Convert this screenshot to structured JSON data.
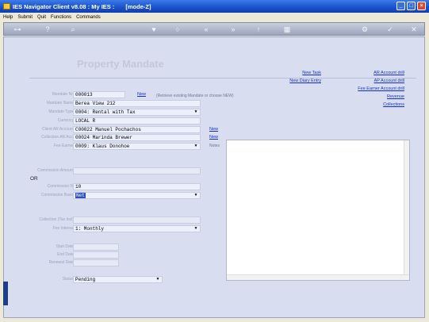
{
  "window": {
    "title": "IES Navigator Client v8.08 : My IES :",
    "mode": "[mode-Z]",
    "minimize": "_",
    "maximize": "□",
    "close": "×"
  },
  "menu": [
    "Help",
    "Submit",
    "Quit",
    "Functions",
    "Commands"
  ],
  "toolbar_icons": [
    "key-icon",
    "question-icon",
    "search-icon",
    "heart-icon",
    "globe-icon",
    "rewind-icon",
    "fast-forward-icon",
    "upload-icon",
    "calculator-icon",
    "settings-icon",
    "check-icon",
    "close-icon"
  ],
  "page_title": "Property Mandate",
  "form": {
    "mandate_no": {
      "label": "Mandate No",
      "value": "000013"
    },
    "new_link": "New",
    "new_hint": "(Retrieve existing Mandate or choose NEW)",
    "mandate_name": {
      "label": "Mandate Name",
      "value": "Berea View 212"
    },
    "mandate_type": {
      "label": "Mandate Type",
      "value": "0004: Rental with Tax"
    },
    "currency": {
      "label": "Currency",
      "value": "LOCAL R"
    },
    "client_ar_account": {
      "label": "Client AR Account",
      "value": "C00022 Manuel Pochachos"
    },
    "collection_ar": {
      "label": "Collection AR Acct",
      "value": "00024 Marinda Brewer"
    },
    "fee_earner": {
      "label": "Fee Earner",
      "value": "0009: Klaus Donohoe"
    },
    "commission_amount": {
      "label": "Commission Amount",
      "value": ""
    },
    "or_text": "OR",
    "commission_pct": {
      "label": "Commission %",
      "value": "10"
    },
    "commission_basis": {
      "label": "Commission Basis",
      "value": "Net"
    },
    "collection_fee": {
      "label": "Collection (Tax Incl)",
      "value": ""
    },
    "fee_interval": {
      "label": "Fee Interval",
      "value": "1: Monthly"
    },
    "start_date": {
      "label": "Start Date",
      "value": ""
    },
    "end_date": {
      "label": "End Date",
      "value": ""
    },
    "renewal_date": {
      "label": "Renewal Date",
      "value": ""
    },
    "status": {
      "label": "Status",
      "value": "Pending"
    },
    "client_new_link": "New",
    "collection_new_link": "New",
    "notes_label": "Notes"
  },
  "actions_mid": [
    "New Task",
    "New Diary Entry"
  ],
  "actions_right": [
    "AR Account drill",
    "AP Account drill",
    "Fee Earner Account drill",
    "Revenue",
    "Collections"
  ]
}
